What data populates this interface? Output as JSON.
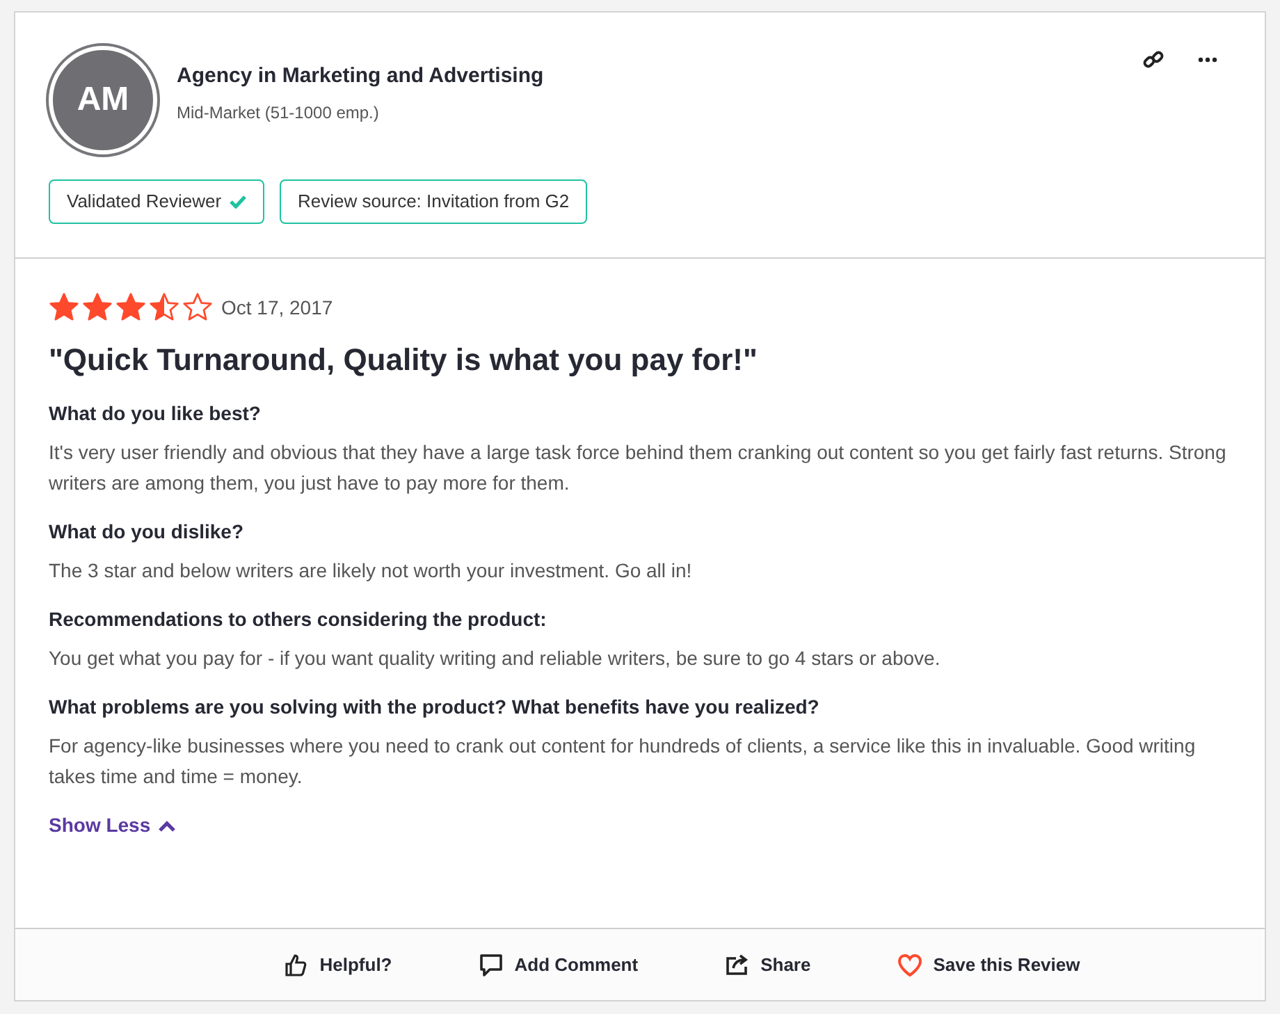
{
  "reviewer": {
    "initials": "AM",
    "name": "Agency in Marketing and Advertising",
    "segment": "Mid-Market (51-1000 emp.)"
  },
  "badges": [
    {
      "label": "Validated Reviewer",
      "verified": true
    },
    {
      "label": "Review source: Invitation from G2",
      "verified": false
    }
  ],
  "review": {
    "stars": 3.5,
    "date": "Oct 17, 2017",
    "title": "\"Quick Turnaround, Quality is what you pay for!\"",
    "sections": [
      {
        "question": "What do you like best?",
        "answer": "It's very user friendly and obvious that they have a large task force behind them cranking out content so you get fairly fast returns. Strong writers are among them, you just have to pay more for them."
      },
      {
        "question": "What do you dislike?",
        "answer": "The 3 star and below writers are likely not worth your investment. Go all in!"
      },
      {
        "question": "Recommendations to others considering the product:",
        "answer": "You get what you pay for - if you want quality writing and reliable writers, be sure to go 4 stars or above."
      },
      {
        "question": "What problems are you solving with the product? What benefits have you realized?",
        "answer": "For agency-like businesses where you need to crank out content for hundreds of clients, a service like this in invaluable. Good writing takes time and time = money."
      }
    ],
    "toggle": "Show Less"
  },
  "actions": [
    {
      "kind": "helpful",
      "label": "Helpful?"
    },
    {
      "kind": "comment",
      "label": "Add Comment"
    },
    {
      "kind": "share",
      "label": "Share"
    },
    {
      "kind": "save",
      "label": "Save this Review"
    }
  ]
}
